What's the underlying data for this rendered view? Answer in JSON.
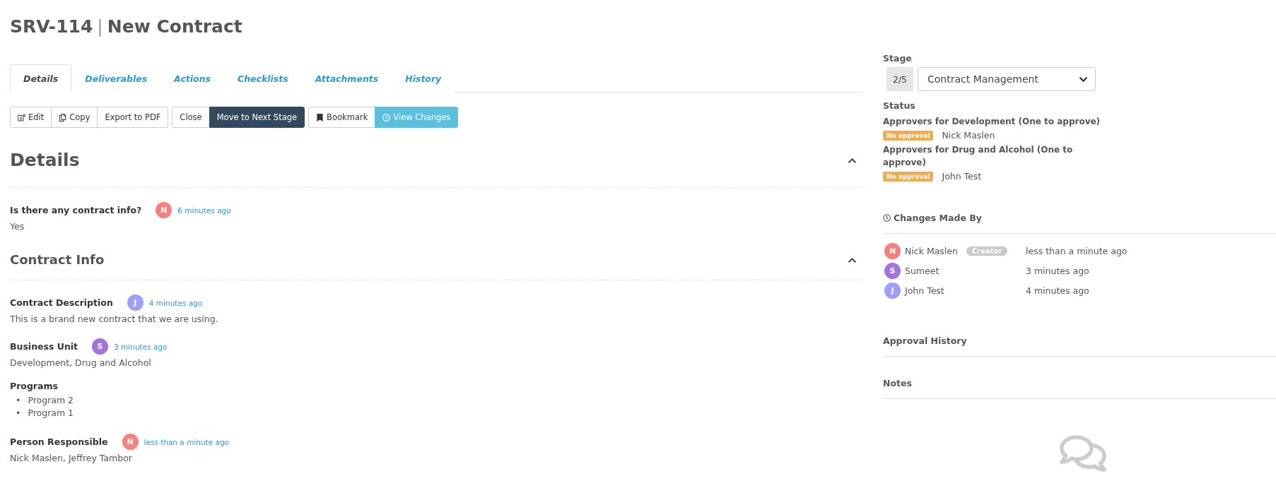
{
  "header": {
    "code": "SRV-114",
    "separator": "|",
    "title": "New Contract"
  },
  "tabs": [
    {
      "label": "Details",
      "selected": true
    },
    {
      "label": "Deliverables",
      "selected": false
    },
    {
      "label": "Actions",
      "selected": false
    },
    {
      "label": "Checklists",
      "selected": false
    },
    {
      "label": "Attachments",
      "selected": false
    },
    {
      "label": "History",
      "selected": false
    }
  ],
  "toolbar": [
    [
      {
        "label": "Edit",
        "kind": "default"
      },
      {
        "label": "Copy",
        "kind": "default"
      },
      {
        "label": "Export to PDF",
        "kind": "default"
      }
    ],
    [
      {
        "label": "Close",
        "kind": "default"
      },
      {
        "label": "Move to Next Stage",
        "kind": "primary"
      }
    ],
    [
      {
        "label": "Bookmark",
        "kind": "default"
      },
      {
        "label": "View Changes",
        "kind": "info"
      }
    ]
  ],
  "sections": [
    {
      "title": "Details",
      "expanded": true,
      "fields": [
        {
          "label": "Is there any contract info?",
          "avatar": "N",
          "color": "#f77f7f",
          "time": "6 minutes ago",
          "value": "Yes"
        }
      ]
    },
    {
      "title": "Contract Info",
      "expanded": true,
      "fields": [
        {
          "label": "Contract Description",
          "avatar": "J",
          "color": "#9d9ff8",
          "time": "4 minutes ago",
          "value": "This is a brand new contract that we are using."
        },
        {
          "label": "Business Unit",
          "avatar": "S",
          "color": "#a374dc",
          "time": "3 minutes ago",
          "value": "Development, Drug and Alcohol"
        },
        {
          "label": "Programs",
          "items": [
            {
              "marker": "•",
              "text": "Program 2"
            },
            {
              "marker": "•",
              "text": "Program 1"
            }
          ]
        },
        {
          "label": "Person Responsible",
          "avatar": "N",
          "color": "#f77f7f",
          "time": "less than a minute ago",
          "value": "Nick Maslen, Jeffrey Tambor"
        }
      ]
    }
  ],
  "stage": {
    "label": "Stage",
    "step": "2/5",
    "value": "Contract Management"
  },
  "status": {
    "label": "Status",
    "groups": [
      {
        "title": "Approvers for Development (One to approve)",
        "badge": "No approval",
        "person": "Nick Maslen"
      },
      {
        "title": "Approvers for Drug and Alcohol (One to approve)",
        "badge": "No approval",
        "person": "John Test"
      }
    ]
  },
  "changes": {
    "title": "Changes Made By",
    "rows": [
      {
        "avatar": "N",
        "color": "#f77f7f",
        "name": "Nick Maslen",
        "tag": "Creator",
        "time": "less than a minute ago"
      },
      {
        "avatar": "S",
        "color": "#a374dc",
        "name": "Sumeet",
        "time": "3 minutes ago"
      },
      {
        "avatar": "J",
        "color": "#9d9ff8",
        "name": "John Test",
        "time": "4 minutes ago"
      }
    ]
  },
  "approval_history": {
    "title": "Approval History"
  },
  "notes": {
    "title": "Notes"
  }
}
